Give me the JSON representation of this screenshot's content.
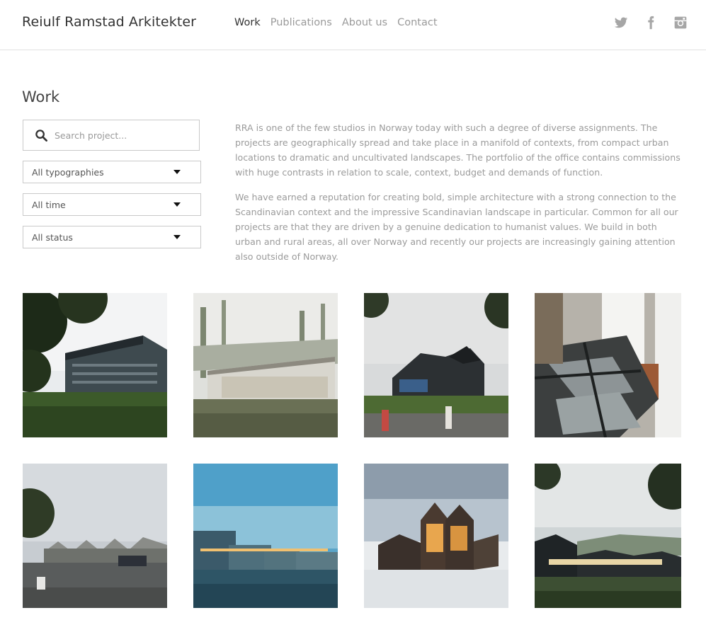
{
  "header": {
    "logo": "Reiulf Ramstad Arkitekter",
    "nav": [
      {
        "label": "Work",
        "active": true
      },
      {
        "label": "Publications",
        "active": false
      },
      {
        "label": "About us",
        "active": false
      },
      {
        "label": "Contact",
        "active": false
      }
    ],
    "social": [
      "twitter-icon",
      "facebook-icon",
      "instagram-icon"
    ]
  },
  "page": {
    "title": "Work"
  },
  "filters": {
    "search_placeholder": "Search project...",
    "typography": "All typographies",
    "time": "All time",
    "status": "All status"
  },
  "intro": {
    "paragraphs": [
      "RRA is one of the few studios in Norway today with such a degree of diverse assignments. The projects are geographically spread and take place in a manifold of contexts, from compact urban locations to dramatic and uncultivated landscapes. The portfolio of the office contains commissions with huge contrasts in relation to scale, context, budget and demands of function.",
      "We have earned a reputation for creating bold, simple architecture with a strong connection to the Scandinavian context and the impressive Scandinavian landscape in particular. Common for all our projects are that they are driven by a genuine dedication to humanist values. We build in both urban and rural areas, all over Norway and recently our projects are increasingly gaining attention also outside of Norway."
    ]
  },
  "colors": {
    "text_dark": "#333333",
    "text_muted": "#9b9b9b",
    "border": "#c9c9c9"
  }
}
